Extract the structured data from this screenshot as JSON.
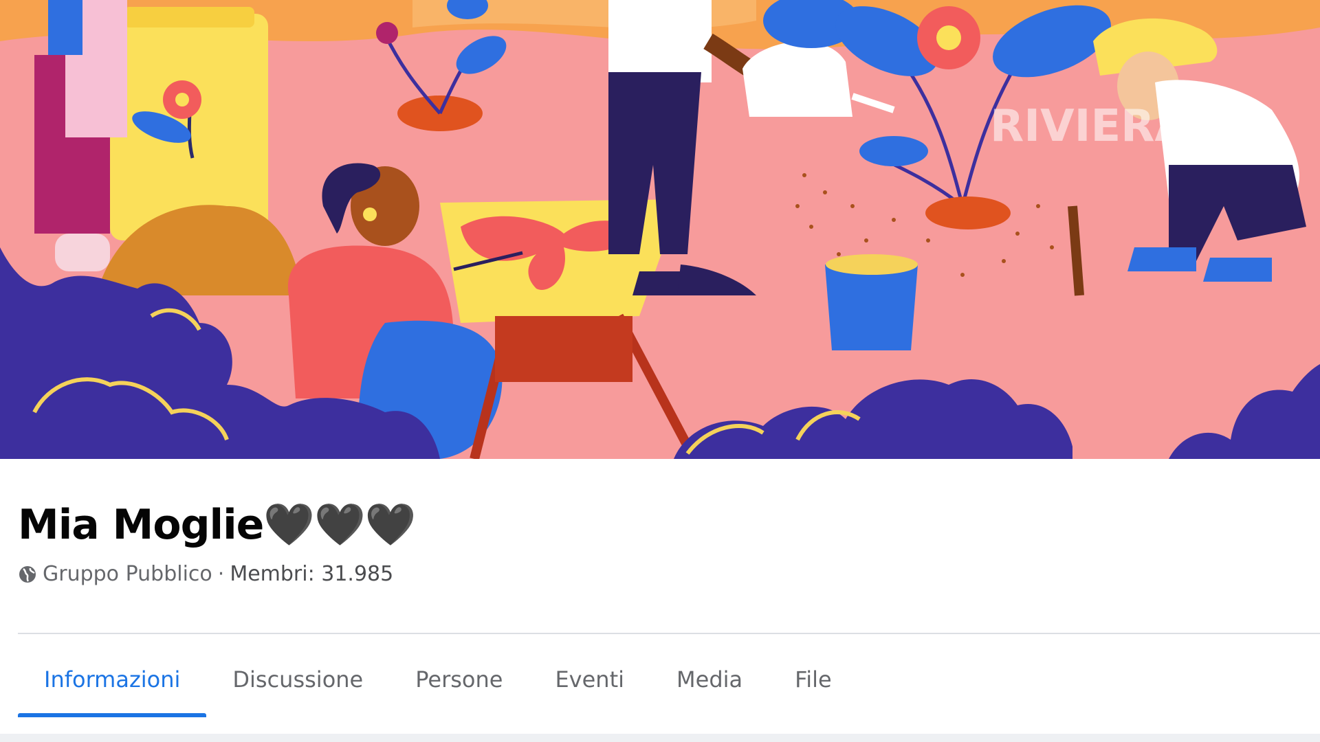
{
  "cover": {
    "image": "group-cover-illustration",
    "watermark": "RIVIERA",
    "colors": {
      "sky": "#f7a24e",
      "ground": "#f79b9b",
      "bush": "#3d2f9e",
      "bush_outline": "#f5d25a",
      "accent_red": "#f25c5c",
      "accent_yellow": "#fbe05a",
      "accent_blue": "#2f6fe0"
    }
  },
  "group": {
    "name": "Mia Moglie🖤🖤🖤",
    "privacy_icon": "globe-icon",
    "privacy_label": "Gruppo Pubblico",
    "separator": "·",
    "members_label": "Membri: 31.985"
  },
  "tabs": [
    {
      "label": "Informazioni",
      "active": true
    },
    {
      "label": "Discussione",
      "active": false
    },
    {
      "label": "Persone",
      "active": false
    },
    {
      "label": "Eventi",
      "active": false
    },
    {
      "label": "Media",
      "active": false
    },
    {
      "label": "File",
      "active": false
    }
  ],
  "colors": {
    "accent": "#1b74e4",
    "text_primary": "#050505",
    "text_secondary": "#65676b"
  }
}
